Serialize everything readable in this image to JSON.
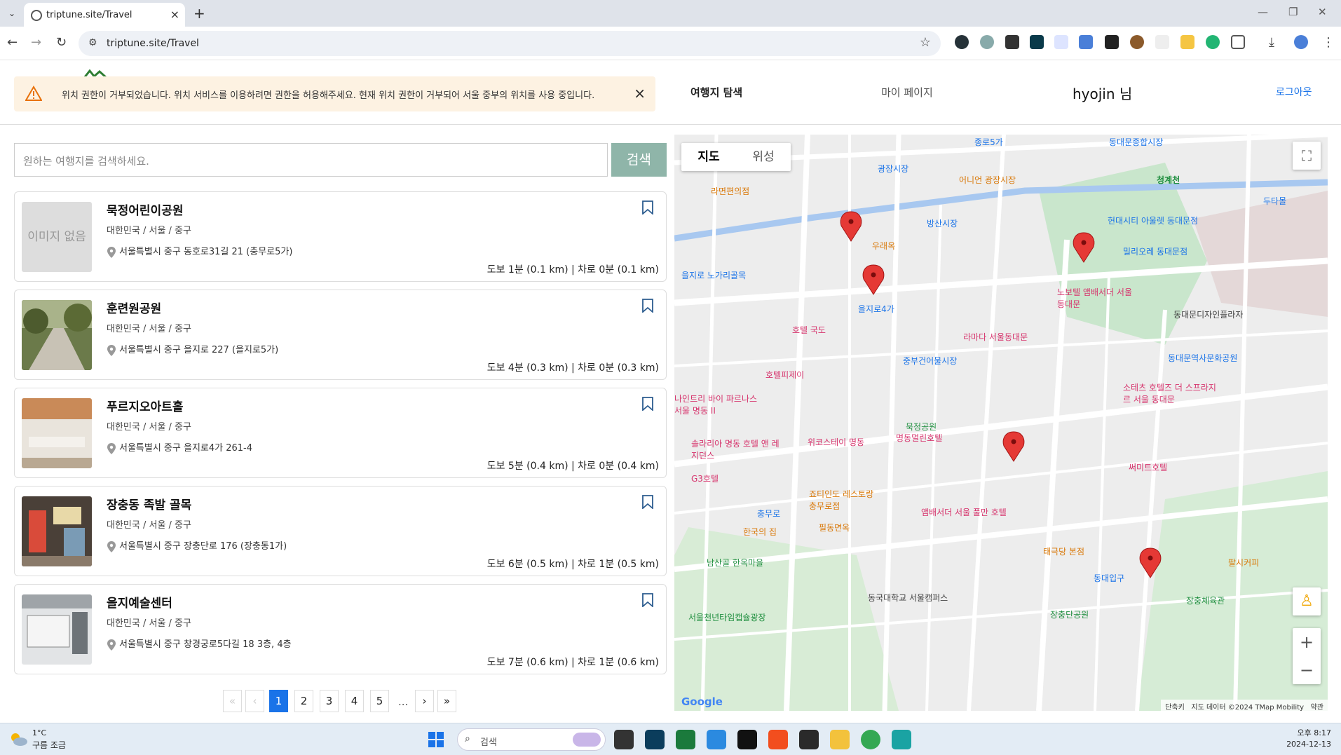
{
  "browser": {
    "tab_title": "triptune.site/Travel",
    "url": "triptune.site/Travel"
  },
  "alert": {
    "message": "위치 권한이 거부되었습니다. 위치 서비스를 이용하려면 권한을 허용해주세요. 현재 위치 권한이 거부되어 서울 중부의 위치를 사용 중입니다."
  },
  "nav": {
    "explore": "여행지 탐색",
    "mypage": "마이 페이지",
    "user": "hyojin 님",
    "logout": "로그아웃"
  },
  "search": {
    "placeholder": "원하는 여행지를 검색하세요.",
    "button": "검색"
  },
  "no_image_text": "이미지 없음",
  "places": [
    {
      "title": "묵정어린이공원",
      "region": "대한민국 / 서울 / 중구",
      "address": "서울특별시 중구 동호로31길 21 (충무로5가)",
      "distance": "도보 1분 (0.1 km)  |  차로 0분 (0.1 km)"
    },
    {
      "title": "훈련원공원",
      "region": "대한민국 / 서울 / 중구",
      "address": "서울특별시 중구 을지로 227 (을지로5가)",
      "distance": "도보 4분 (0.3 km)  |  차로 0분 (0.3 km)"
    },
    {
      "title": "푸르지오아트홀",
      "region": "대한민국 / 서울 / 중구",
      "address": "서울특별시 중구 을지로4가 261-4",
      "distance": "도보 5분 (0.4 km)  |  차로 0분 (0.4 km)"
    },
    {
      "title": "장충동 족발 골목",
      "region": "대한민국 / 서울 / 중구",
      "address": "서울특별시 중구 장충단로 176 (장충동1가)",
      "distance": "도보 6분 (0.5 km)  |  차로 1분 (0.5 km)"
    },
    {
      "title": "을지예술센터",
      "region": "대한민국 / 서울 / 중구",
      "address": "서울특별시 중구 창경궁로5다길 18 3층, 4층",
      "distance": "도보 7분 (0.6 km)  |  차로 1분 (0.6 km)"
    }
  ],
  "pagination": {
    "first": "«",
    "prev": "‹",
    "pages": [
      "1",
      "2",
      "3",
      "4",
      "5"
    ],
    "current": "1",
    "ellipsis": "...",
    "next": "›",
    "last": "»"
  },
  "map": {
    "type_map": "지도",
    "type_satellite": "위성",
    "google": "Google",
    "shortcuts": "단축키",
    "credit": "지도 데이터 ©2024 TMap Mobility",
    "terms": "약관",
    "labels": {
      "jongno5": "종로5가",
      "dongdaemun_market": "동대문종합시장",
      "gwangjang": "광장시장",
      "eoneunal": "어니언 광장시장",
      "ramyeon": "라면편의점",
      "cheonggyecheon": "청계천",
      "bangsan": "방산시장",
      "woorae": "우래옥",
      "euljiro_alley": "을지로 노가리골목",
      "hotel_kukdo": "호텔 국도",
      "euljiro4": "을지로4가",
      "ramada": "라마다 서울동대문",
      "novotel": "노보텔 앰배서더 서울 동대문",
      "hyundai_outlet": "현대시티 아울렛 동대문점",
      "milliore": "밀리오레 동대문점",
      "ddp": "동대문디자인플라자",
      "ddp_station": "동대문역사문화공원",
      "hotel_pije": "호텔피제이",
      "joongbu": "중부건어물시장",
      "ninetree": "나인트리 바이 파르나스 서울 명동 II",
      "mukjeong": "묵정공원",
      "sotetsu": "소테츠 호텔즈 더 스프라지르 서울 동대문",
      "solaria": "솔라리아 명동 호텔 앤 레지던스",
      "wikostay": "위코스테이 명동",
      "myeongdong_hotel": "명동멀린호텔",
      "summit": "써미트호텔",
      "g3": "G3호텔",
      "jotin": "죠티인도 레스토랑 충무로점",
      "chungmuro": "충무로",
      "ambassador_pullman": "앰배서더 서울 풀만 호텔",
      "hankook": "한국의 집",
      "pildong": "필동면옥",
      "namsangol": "남산골 한옥마을",
      "taegukdang": "태극당 본점",
      "palsi": "팔시커피",
      "dongguk": "동국대학교 서울캠퍼스",
      "dongdae_ipgu": "동대입구",
      "jangchung_gym": "장충체육관",
      "jangchung_park": "장충단공원",
      "time_capsule": "서울천년타임캡슐광장",
      "dutamall": "두타몰"
    }
  },
  "taskbar": {
    "temp": "1°C",
    "weather": "구름 조금",
    "search": "검색",
    "time": "오후 8:17",
    "date": "2024-12-13"
  }
}
